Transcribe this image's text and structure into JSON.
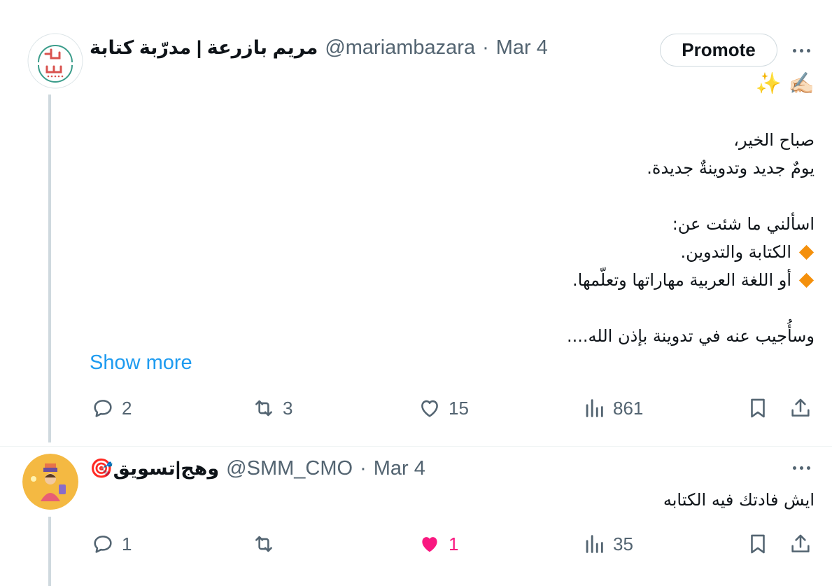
{
  "tweet1": {
    "author_name": "مريم بازرعة | مدرّبة كتابة",
    "handle": "@mariambazara",
    "separator": "·",
    "date": "Mar 4",
    "promote_label": "Promote",
    "emoji_line": "✍🏻 ✨",
    "lines": [
      "صباح الخير،",
      "يومٌ جديد وتدوينةٌ جديدة.",
      "",
      "اسألني ما شئت عن:",
      "الكتابة والتدوين.",
      "أو اللغة العربية مهاراتها وتعلّمها.",
      "",
      "وسأُجيب عنه في تدوينة بإذن الله...."
    ],
    "show_more": "Show more",
    "replies": "2",
    "retweets": "3",
    "likes": "15",
    "views": "861"
  },
  "tweet2": {
    "author_name": "🎯وهج|تسويق",
    "handle": "@SMM_CMO",
    "separator": "·",
    "date": "Mar 4",
    "text": "ايش فادتك فيه الكتابه",
    "replies": "1",
    "retweets": "",
    "likes": "1",
    "views": "35"
  },
  "colors": {
    "accent": "#1d9bf0",
    "muted": "#536471",
    "like": "#f91880",
    "bullet": "#f4900c"
  }
}
